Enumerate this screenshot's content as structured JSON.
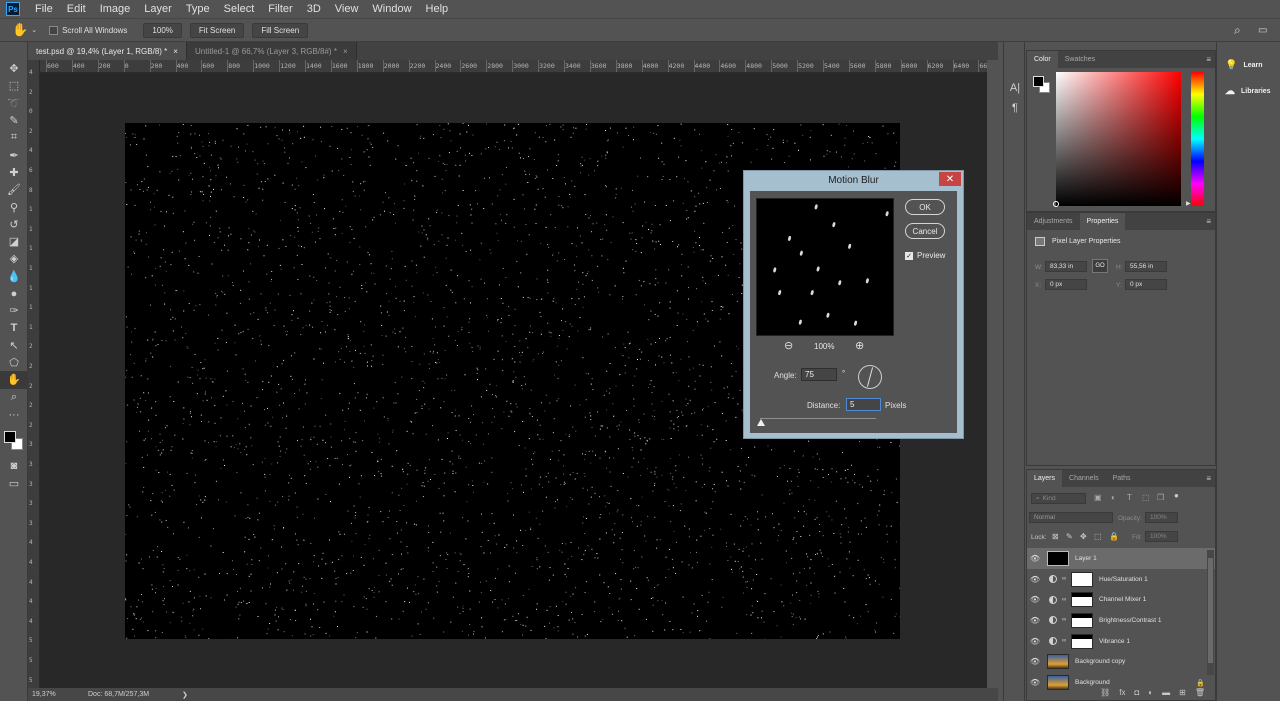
{
  "menu": [
    "File",
    "Edit",
    "Image",
    "Layer",
    "Type",
    "Select",
    "Filter",
    "3D",
    "View",
    "Window",
    "Help"
  ],
  "options": {
    "scroll_all": "Scroll All Windows",
    "zoom": "100%",
    "fit": "Fit Screen",
    "fill": "Fill Screen"
  },
  "tabs": [
    {
      "label": "test.psd @ 19,4% (Layer 1, RGB/8) *",
      "close": "×"
    },
    {
      "label": "Untitled-1 @ 66,7% (Layer 3, RGB/8#) *",
      "close": "×"
    }
  ],
  "ruler": {
    "h": [
      "600",
      "400",
      "200",
      "0",
      "200",
      "400",
      "600",
      "800",
      "1000",
      "1200",
      "1400",
      "1600",
      "1800",
      "2000",
      "2200",
      "2400",
      "2600",
      "2800",
      "3000",
      "3200",
      "3400",
      "3600",
      "3800",
      "4000",
      "4200",
      "4400",
      "4600",
      "4800",
      "5000",
      "5200",
      "5400",
      "5600",
      "5800",
      "6000",
      "6200",
      "6400",
      "66"
    ],
    "v": [
      "4",
      "2",
      "0",
      "2",
      "4",
      "6",
      "8",
      "1",
      "1",
      "1",
      "1",
      "1",
      "1",
      "1",
      "2",
      "2",
      "2",
      "2",
      "2",
      "3",
      "3",
      "3",
      "3",
      "3",
      "4",
      "4",
      "4",
      "4",
      "4",
      "5",
      "5",
      "5"
    ]
  },
  "status": {
    "zoom": "19,37%",
    "doc": "Doc: 68,7M/257,3M",
    "arrow": "❯"
  },
  "color_panel": {
    "tabs": [
      "Color",
      "Swatches"
    ],
    "menu": "≡"
  },
  "properties_panel": {
    "tabs": [
      "Adjustments",
      "Properties"
    ],
    "menu": "≡",
    "title": "Pixel Layer Properties",
    "w_label": "W:",
    "w": "83,33 in",
    "h_label": "H:",
    "h": "55,56 in",
    "x_label": "X:",
    "x": "0 px",
    "y_label": "Y:",
    "y": "0 px",
    "link_icon": "GO"
  },
  "layers_panel": {
    "tabs": [
      "Layers",
      "Channels",
      "Paths"
    ],
    "menu": "≡",
    "kind": "Kind",
    "blend": "Normal",
    "opacity_label": "Opacity:",
    "opacity": "100%",
    "lock_label": "Lock:",
    "fill_label": "Fill:",
    "fill": "100%",
    "layers": [
      {
        "name": "Layer 1",
        "type": "pixel",
        "selected": true
      },
      {
        "name": "Hue/Saturation 1",
        "type": "adjustment",
        "selected": false
      },
      {
        "name": "Channel Mixer 1",
        "type": "adjustment",
        "selected": false
      },
      {
        "name": "Brightness/Contrast 1",
        "type": "adjustment",
        "selected": false
      },
      {
        "name": "Vibrance 1",
        "type": "adjustment",
        "selected": false
      },
      {
        "name": "Background copy",
        "type": "image",
        "selected": false
      },
      {
        "name": "Background",
        "type": "image",
        "selected": false
      }
    ],
    "footer_icons": [
      "link-icon",
      "fx-icon",
      "mask-icon",
      "adjustment-icon",
      "folder-icon",
      "new-layer-icon",
      "trash-icon"
    ]
  },
  "learn_panel": {
    "learn": "Learn",
    "libraries": "Libraries"
  },
  "dialog": {
    "title": "Motion Blur",
    "close": "✕",
    "ok": "OK",
    "cancel": "Cancel",
    "preview_label": "Preview",
    "preview_checked": true,
    "zoom": "100%",
    "angle_label": "Angle:",
    "angle": "75",
    "degree": "°",
    "distance_label": "Distance:",
    "distance": "5",
    "pixels": "Pixels",
    "slider_fraction": 0.01
  },
  "colors": {
    "panel": "#535353",
    "canvas_bg": "#282828",
    "dialog_frame": "#a6bfce",
    "close": "#c74444",
    "selected_layer": "#6b6b6b"
  }
}
